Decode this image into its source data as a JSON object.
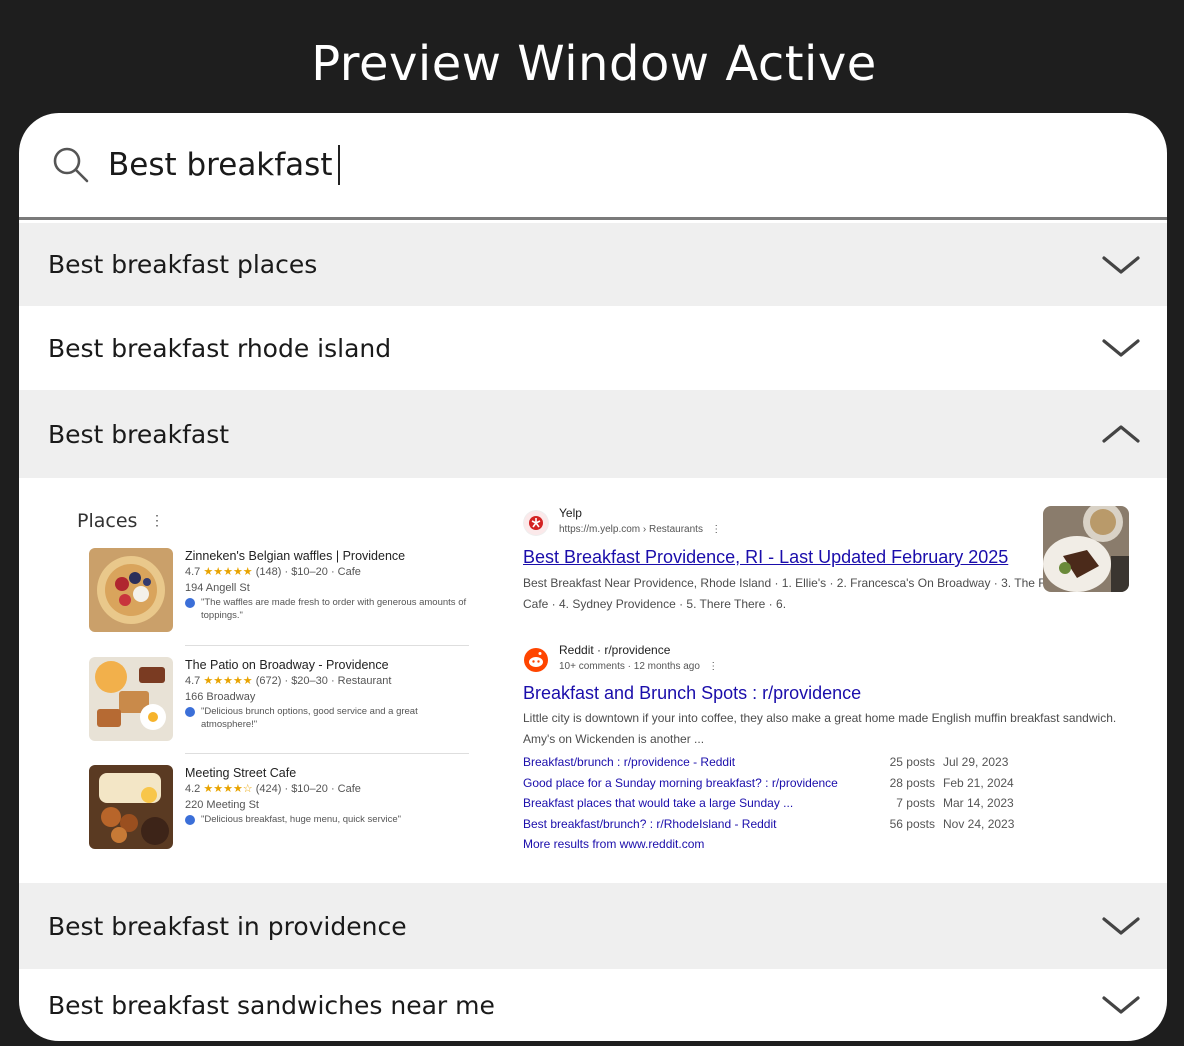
{
  "window": {
    "title": "Preview Window Active"
  },
  "search": {
    "value": "Best breakfast"
  },
  "suggestions": [
    {
      "label": "Best breakfast places",
      "expanded": false
    },
    {
      "label": "Best breakfast rhode island",
      "expanded": false
    },
    {
      "label": "Best breakfast",
      "expanded": true
    },
    {
      "label": "Best breakfast in providence",
      "expanded": false
    },
    {
      "label": "Best breakfast sandwiches near me",
      "expanded": false
    }
  ],
  "preview": {
    "places_title": "Places",
    "places_menu": "⋮",
    "places": [
      {
        "name": "Zinneken's Belgian waffles | Providence",
        "rating": "4.7",
        "stars": "★★★★★",
        "meta": "(148) · $10–20 · Cafe",
        "address": "194 Angell St",
        "review": "\"The waffles are made fresh to order with generous amounts of toppings.\""
      },
      {
        "name": "The Patio on Broadway - Providence",
        "rating": "4.7",
        "stars": "★★★★★",
        "meta": "(672) · $20–30 · Restaurant",
        "address": "166 Broadway",
        "review": "\"Delicious brunch options, good service and a great atmosphere!\""
      },
      {
        "name": "Meeting Street Cafe",
        "rating": "4.2",
        "stars": "★★★★☆",
        "meta": "(424) · $10–20 · Cafe",
        "address": "220 Meeting St",
        "review": "\"Delicious breakfast, huge menu, quick service\""
      }
    ],
    "results": [
      {
        "site": "Yelp",
        "url": "https://m.yelp.com › Restaurants",
        "menu": "⋮",
        "title": "Best Breakfast Providence, RI - Last Updated February 2025",
        "snippet": "Best Breakfast Near Providence, Rhode Island · 1. Ellie's · 2. Francesca's On Broadway · 3. The Rhody Hen Cafe · 4. Sydney Providence · 5. There There · 6."
      },
      {
        "site": "Reddit · r/providence",
        "url": "10+ comments · 12 months ago",
        "menu": "⋮",
        "title": "Breakfast and Brunch Spots : r/providence",
        "snippet": "Little city is downtown if your into coffee, they also make a great home made English muffin breakfast sandwich. Amy's on Wickenden is another ...",
        "sub_results": [
          {
            "title": "Breakfast/brunch : r/providence - Reddit",
            "posts": "25 posts",
            "date": "Jul 29, 2023"
          },
          {
            "title": "Good place for a Sunday morning breakfast? : r/providence",
            "posts": "28 posts",
            "date": "Feb 21, 2024"
          },
          {
            "title": "Breakfast places that would take a large Sunday ...",
            "posts": "7 posts",
            "date": "Mar 14, 2023"
          },
          {
            "title": "Best breakfast/brunch? : r/RhodeIsland - Reddit",
            "posts": "56 posts",
            "date": "Nov 24, 2023"
          }
        ],
        "more_link": "More results from www.reddit.com"
      }
    ]
  },
  "colors": {
    "background": "#1e1e1e",
    "panel": "#ffffff",
    "shaded_row": "#efefef",
    "link": "#1a0dab"
  }
}
